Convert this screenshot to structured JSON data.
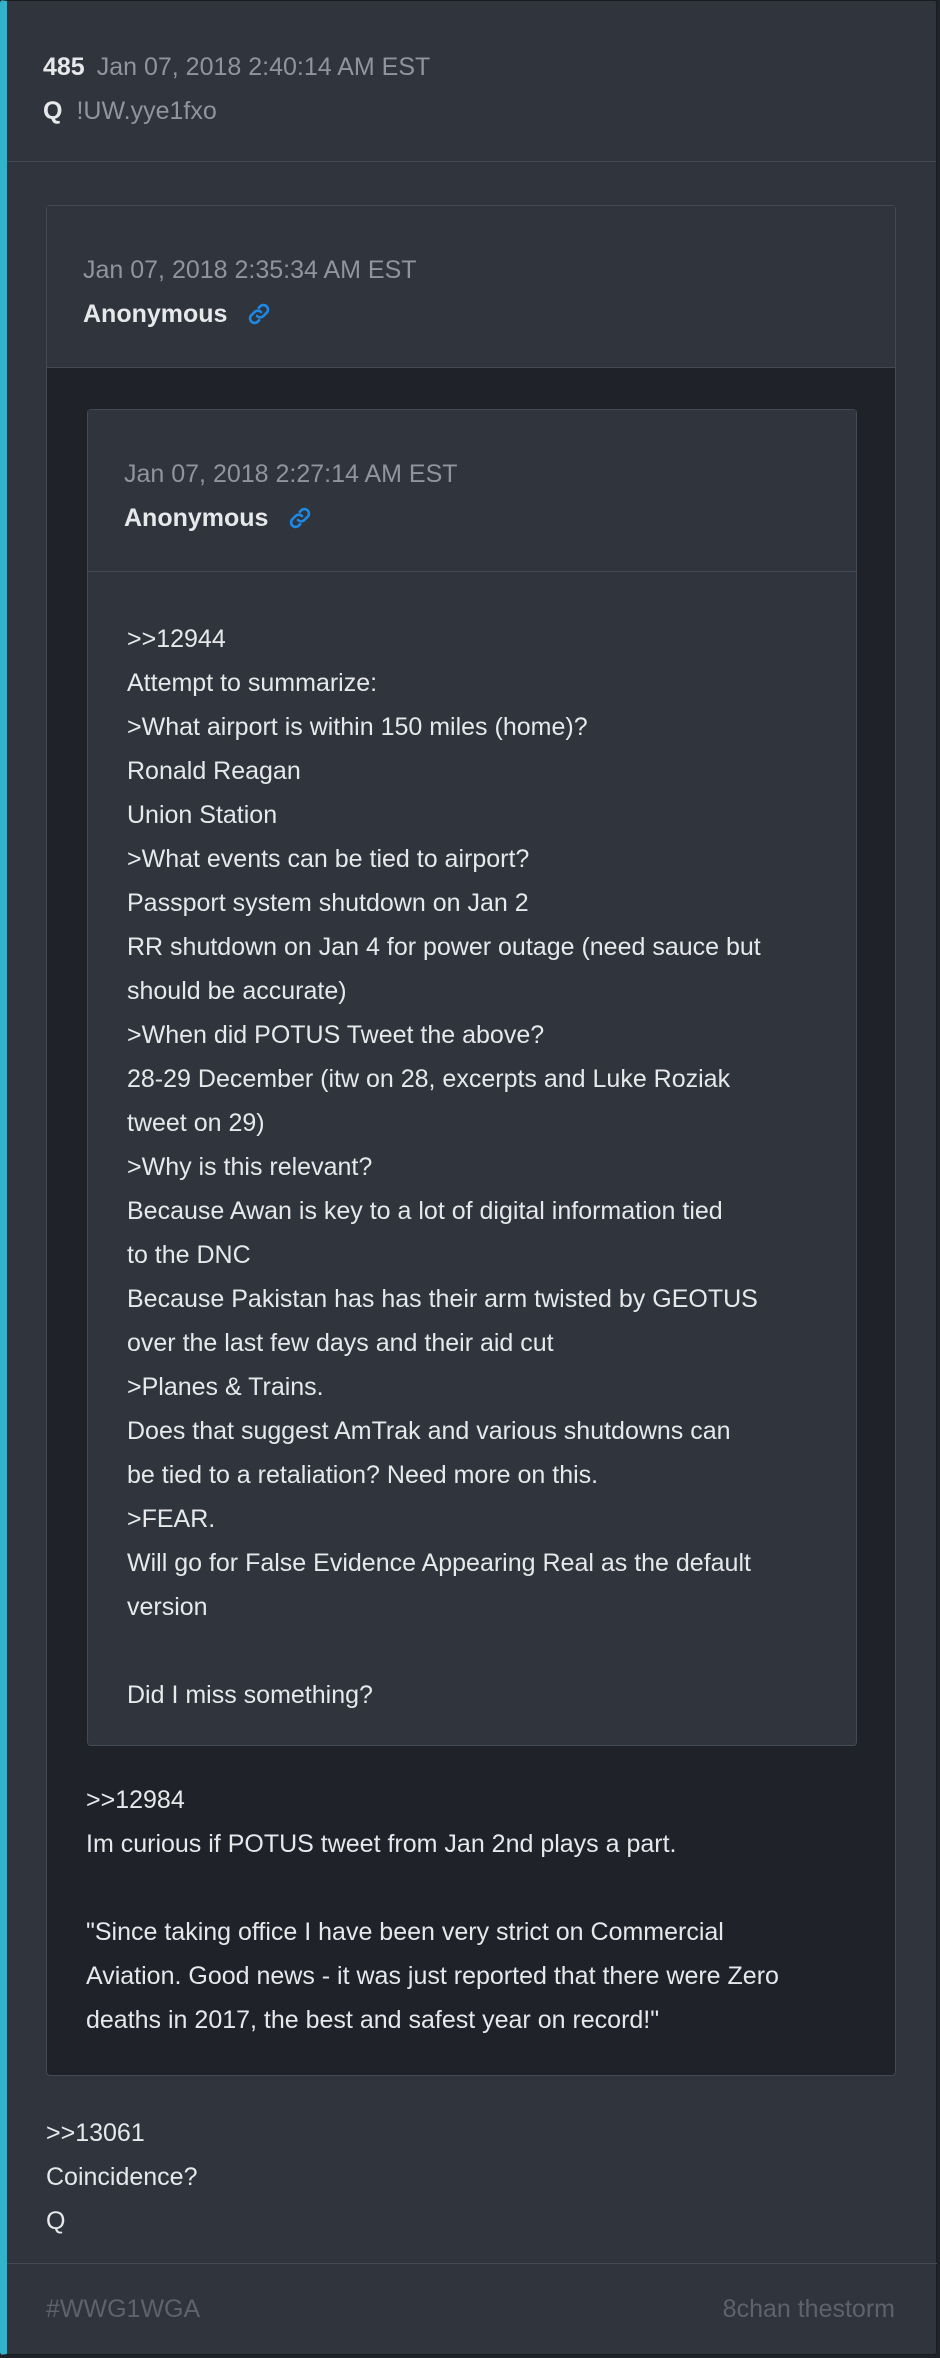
{
  "post": {
    "number": "485",
    "date": "Jan 07, 2018 2:40:14 AM EST",
    "name": "Q",
    "tripcode": "!UW.yye1fxo",
    "body": ">>13061\nCoincidence?\nQ"
  },
  "quote": {
    "date": "Jan 07, 2018 2:35:34 AM EST",
    "author": "Anonymous",
    "link_icon": "link-icon",
    "body": ">>12984\nIm curious if POTUS tweet from Jan 2nd plays a part.\n\n\"Since taking office I have been very strict on Commercial\nAviation. Good news - it was just reported that there were Zero\ndeaths in 2017, the best and safest year on record!\"",
    "nested": {
      "date": "Jan 07, 2018 2:27:14 AM EST",
      "author": "Anonymous",
      "link_icon": "link-icon",
      "body": ">>12944\nAttempt to summarize:\n>What airport is within 150 miles (home)?\nRonald Reagan\nUnion Station\n>What events can be tied to airport?\nPassport system shutdown on Jan 2\nRR shutdown on Jan 4 for power outage (need sauce but\nshould be accurate)\n>When did POTUS Tweet the above?\n28-29 December (itw on 28, excerpts and Luke Roziak\ntweet on 29)\n>Why is this relevant?\nBecause Awan is key to a lot of digital information tied\nto the DNC\nBecause Pakistan has has their arm twisted by GEOTUS\nover the last few days and their aid cut\n>Planes & Trains.\nDoes that suggest AmTrak and various shutdowns can\nbe tied to a retaliation? Need more on this.\n>FEAR.\nWill go for False Evidence Appearing Real as the default\nversion\n\nDid I miss something?"
    }
  },
  "footer": {
    "tag": "#WWG1WGA",
    "source": "8chan thestorm"
  },
  "colors": {
    "accent": "#33b3c9",
    "link": "#1e88e5",
    "card_bg": "#2f343d",
    "page_bg": "#1f2329"
  }
}
